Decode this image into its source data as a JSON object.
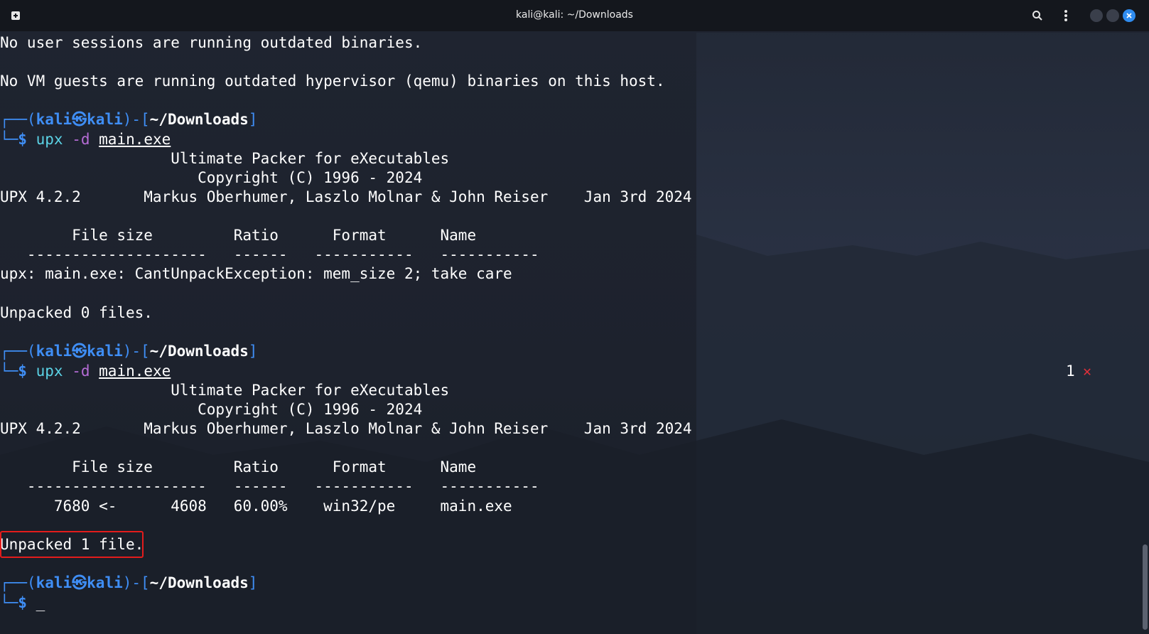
{
  "window": {
    "title": "kali@kali: ~/Downloads",
    "accent": "#3f8ef5",
    "highlight_color": "#e31c1c"
  },
  "titlebar_icons": [
    "new-tab-icon",
    "search-icon",
    "menu-dots-icon"
  ],
  "prompt": {
    "open": "┌──(",
    "user": "kali",
    "at_symbol": "㉿",
    "host": "kali",
    "mid": ")-[",
    "cwd": "~/Downloads",
    "close": "]",
    "second_line": "└─",
    "dollar": "$"
  },
  "lines": {
    "l1": "No user sessions are running outdated binaries.",
    "l2": "No VM guests are running outdated hypervisor (qemu) binaries on this host.",
    "cmd1_tool": "upx",
    "cmd1_flag": "-d",
    "cmd1_file": "main.exe",
    "banner1": "                   Ultimate Packer for eXecutables",
    "banner2": "                      Copyright (C) 1996 - 2024",
    "banner3": "UPX 4.2.2       Markus Oberhumer, Laszlo Molnar & John Reiser    Jan 3rd 2024",
    "header": "        File size         Ratio      Format      Name",
    "dashes": "   --------------------   ------   -----------   -----------",
    "error": "upx: main.exe: CantUnpackException: mem_size 2; take care",
    "unpacked0": "Unpacked 0 files.",
    "row": "      7680 <-      4608   60.00%    win32/pe     main.exe",
    "unpacked1": "Unpacked 1 file.",
    "cursor": "_"
  },
  "status": {
    "exit_code": "1",
    "exit_mark": "✕"
  }
}
